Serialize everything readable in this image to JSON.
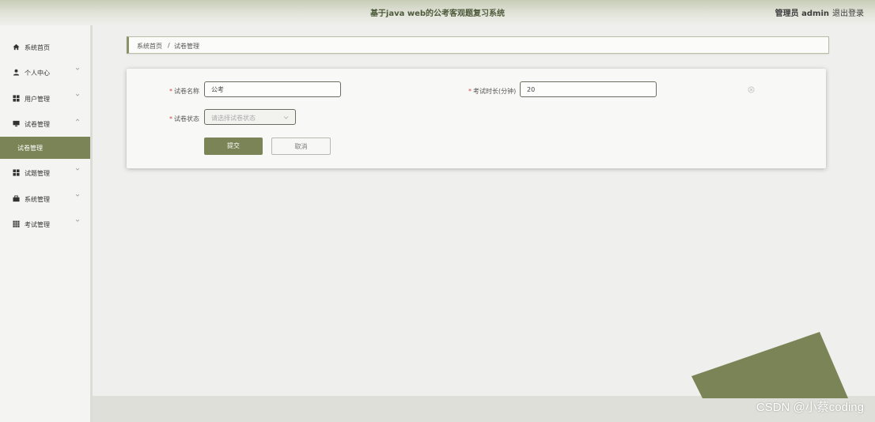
{
  "header": {
    "title": "基于java web的公考客观题复习系统",
    "user": "管理员 admin",
    "logout": "退出登录"
  },
  "sidebar": {
    "items": [
      {
        "label": "系统首页",
        "icon": "home-icon"
      },
      {
        "label": "个人中心",
        "icon": "user-icon"
      },
      {
        "label": "用户管理",
        "icon": "grid-icon"
      },
      {
        "label": "试卷管理",
        "icon": "monitor-icon"
      },
      {
        "label": "试题管理",
        "icon": "grid-icon"
      },
      {
        "label": "系统管理",
        "icon": "briefcase-icon"
      },
      {
        "label": "考试管理",
        "icon": "table-icon"
      }
    ],
    "active_sub": "试卷管理"
  },
  "breadcrumb": {
    "home": "系统首页",
    "sep": "/",
    "current": "试卷管理"
  },
  "form": {
    "name_label": "试卷名称",
    "name_value": "公考",
    "duration_label": "考试时长(分钟)",
    "duration_value": "20",
    "status_label": "试卷状态",
    "status_placeholder": "请选择试卷状态",
    "submit_label": "提交",
    "cancel_label": "取消",
    "required_mark": "*"
  },
  "watermark": "CSDN @小蔡coding",
  "colors": {
    "accent": "#7b8456",
    "background": "#efefed",
    "required": "#d04848"
  }
}
